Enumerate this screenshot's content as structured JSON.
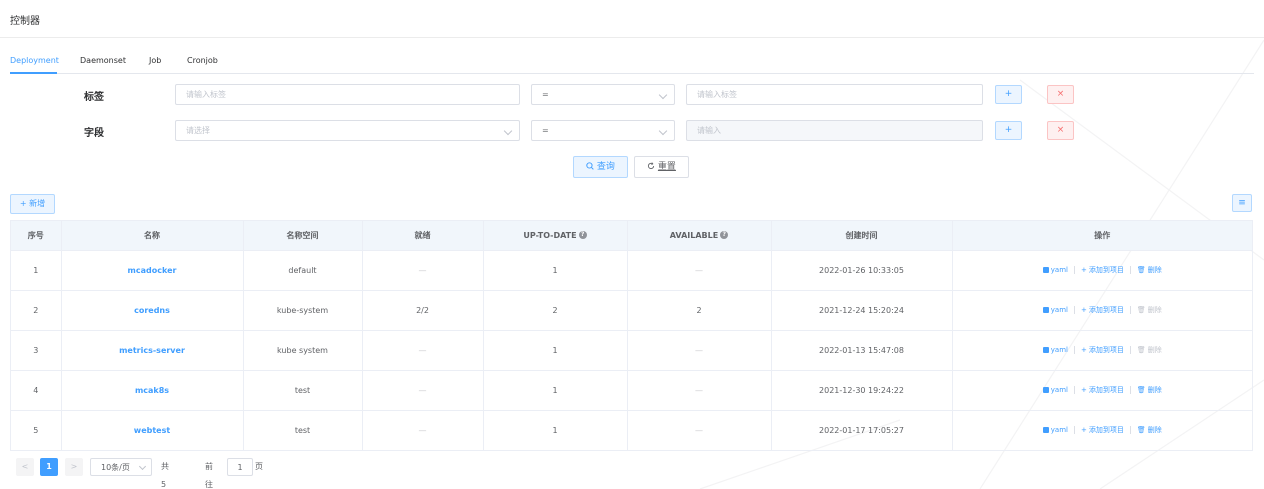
{
  "header": {
    "title": "控制器"
  },
  "tabs": [
    {
      "label": "Deployment",
      "active": true
    },
    {
      "label": "Daemonset"
    },
    {
      "label": "Job"
    },
    {
      "label": "Cronjob"
    }
  ],
  "filters": {
    "label_row": {
      "label": "标签",
      "key_placeholder": "请输入标签",
      "operator": "=",
      "value_placeholder": "请输入标签",
      "add_symbol": "+",
      "remove_symbol": "×"
    },
    "field_row": {
      "label": "字段",
      "key_placeholder": "请选择",
      "operator": "=",
      "value_placeholder": "请输入",
      "add_symbol": "+",
      "remove_symbol": "×"
    }
  },
  "actions": {
    "query_label": "查询",
    "reset_label": "重置",
    "add_label": "+ 新增",
    "columns_icon": "≡"
  },
  "table": {
    "headers": [
      "序号",
      "名称",
      "名称空间",
      "就绪",
      "UP-TO-DATE",
      "AVAILABLE",
      "创建时间",
      "操作"
    ],
    "help_icon": "?",
    "ops": {
      "yaml": "yaml",
      "add_to_project": "添加到项目",
      "delete": "删除"
    },
    "rows": [
      {
        "no": "1",
        "name": "mcadocker",
        "namespace": "default",
        "ready": "—",
        "uptodate": "1",
        "available": "—",
        "created": "2022-01-26 10:33:05",
        "add_disabled": false,
        "delete_disabled": false
      },
      {
        "no": "2",
        "name": "coredns",
        "namespace": "kube-system",
        "ready": "2/2",
        "uptodate": "2",
        "available": "2",
        "created": "2021-12-24 15:20:24",
        "add_disabled": false,
        "delete_disabled": true
      },
      {
        "no": "3",
        "name": "metrics-server",
        "namespace": "kube system",
        "ready": "—",
        "uptodate": "1",
        "available": "—",
        "created": "2022-01-13 15:47:08",
        "add_disabled": false,
        "delete_disabled": true
      },
      {
        "no": "4",
        "name": "mcak8s",
        "namespace": "test",
        "ready": "—",
        "uptodate": "1",
        "available": "—",
        "created": "2021-12-30 19:24:22",
        "add_disabled": false,
        "delete_disabled": false
      },
      {
        "no": "5",
        "name": "webtest",
        "namespace": "test",
        "ready": "—",
        "uptodate": "1",
        "available": "—",
        "created": "2022-01-17 17:05:27",
        "add_disabled": false,
        "delete_disabled": false
      }
    ]
  },
  "pagination": {
    "prev": "<",
    "current_page": "1",
    "next": ">",
    "page_size": "10条/页",
    "total": "共 5 条",
    "goto_label": "前往",
    "goto_value": "1",
    "page_unit": "页"
  },
  "colors": {
    "accent": "#409eff",
    "danger": "#f56c6c",
    "header_bg": "#f1f6fb"
  }
}
